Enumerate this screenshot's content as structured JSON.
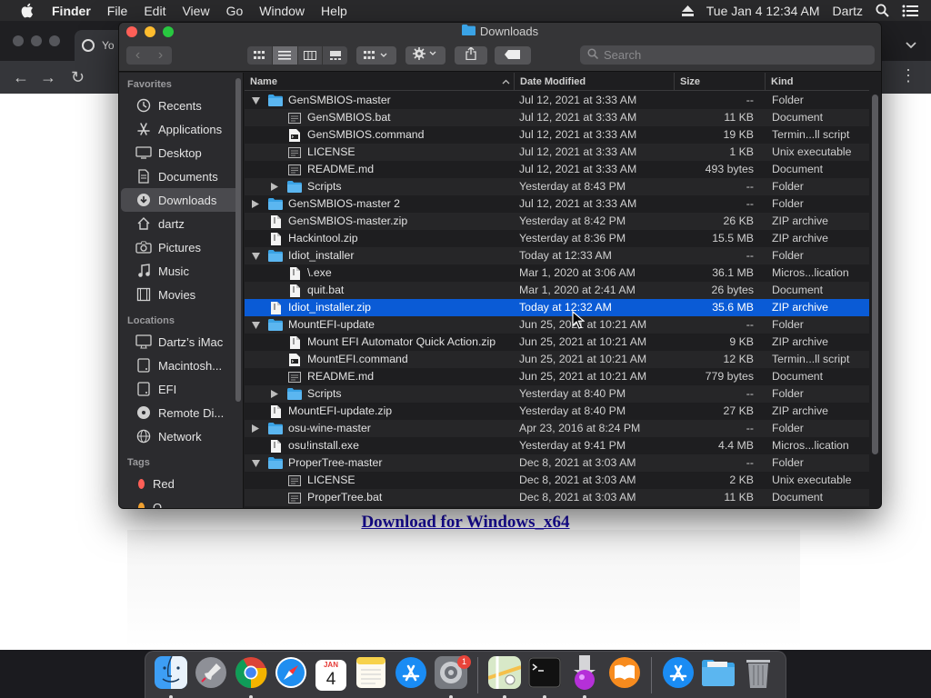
{
  "menubar": {
    "app_name": "Finder",
    "items": [
      "File",
      "Edit",
      "View",
      "Go",
      "Window",
      "Help"
    ],
    "clock": "Tue Jan 4  12:34 AM",
    "user": "Dartz"
  },
  "browser": {
    "tab_title": "Yo",
    "download_link": "Download for Windows_x64"
  },
  "finder": {
    "title": "Downloads",
    "search_placeholder": "Search",
    "columns": {
      "name": "Name",
      "date": "Date Modified",
      "size": "Size",
      "kind": "Kind"
    },
    "sidebar": {
      "favorites_label": "Favorites",
      "favorites": [
        {
          "label": "Recents",
          "icon": "clock-icon"
        },
        {
          "label": "Applications",
          "icon": "applications-icon"
        },
        {
          "label": "Desktop",
          "icon": "desktop-icon"
        },
        {
          "label": "Documents",
          "icon": "document-icon"
        },
        {
          "label": "Downloads",
          "icon": "download-icon",
          "selected": true
        },
        {
          "label": "dartz",
          "icon": "home-icon"
        },
        {
          "label": "Pictures",
          "icon": "camera-icon"
        },
        {
          "label": "Music",
          "icon": "music-icon"
        },
        {
          "label": "Movies",
          "icon": "film-icon"
        }
      ],
      "locations_label": "Locations",
      "locations": [
        {
          "label": "Dartz’s iMac",
          "icon": "imac-icon"
        },
        {
          "label": "Macintosh...",
          "icon": "disk-icon"
        },
        {
          "label": "EFI",
          "icon": "disk-icon"
        },
        {
          "label": "Remote Di...",
          "icon": "remote-disc-icon"
        },
        {
          "label": "Network",
          "icon": "globe-icon"
        }
      ],
      "tags_label": "Tags",
      "tags": [
        {
          "label": "Red",
          "color": "#fe5f57"
        },
        {
          "label": "O",
          "color": "#f0a030"
        }
      ]
    },
    "rows": [
      {
        "name": "GenSMBIOS-master",
        "date": "Jul 12, 2021 at 3:33 AM",
        "size": "--",
        "kind": "Folder",
        "type": "folder",
        "depth": 0,
        "disclosure": "open"
      },
      {
        "name": "GenSMBIOS.bat",
        "date": "Jul 12, 2021 at 3:33 AM",
        "size": "11 KB",
        "kind": "Document",
        "type": "doc",
        "depth": 1,
        "disclosure": "none"
      },
      {
        "name": "GenSMBIOS.command",
        "date": "Jul 12, 2021 at 3:33 AM",
        "size": "19 KB",
        "kind": "Termin...ll script",
        "type": "script",
        "depth": 1,
        "disclosure": "none"
      },
      {
        "name": "LICENSE",
        "date": "Jul 12, 2021 at 3:33 AM",
        "size": "1 KB",
        "kind": "Unix executable",
        "type": "exec",
        "depth": 1,
        "disclosure": "none"
      },
      {
        "name": "README.md",
        "date": "Jul 12, 2021 at 3:33 AM",
        "size": "493 bytes",
        "kind": "Document",
        "type": "doc",
        "depth": 1,
        "disclosure": "none"
      },
      {
        "name": "Scripts",
        "date": "Yesterday at 8:43 PM",
        "size": "--",
        "kind": "Folder",
        "type": "folder",
        "depth": 1,
        "disclosure": "closed"
      },
      {
        "name": "GenSMBIOS-master 2",
        "date": "Jul 12, 2021 at 3:33 AM",
        "size": "--",
        "kind": "Folder",
        "type": "folder",
        "depth": 0,
        "disclosure": "closed"
      },
      {
        "name": "GenSMBIOS-master.zip",
        "date": "Yesterday at 8:42 PM",
        "size": "26 KB",
        "kind": "ZIP archive",
        "type": "file",
        "depth": 0,
        "disclosure": "none"
      },
      {
        "name": "Hackintool.zip",
        "date": "Yesterday at 8:36 PM",
        "size": "15.5 MB",
        "kind": "ZIP archive",
        "type": "file",
        "depth": 0,
        "disclosure": "none"
      },
      {
        "name": "Idiot_installer",
        "date": "Today at 12:33 AM",
        "size": "--",
        "kind": "Folder",
        "type": "folder",
        "depth": 0,
        "disclosure": "open"
      },
      {
        "name": "\\.exe",
        "date": "Mar 1, 2020 at 3:06 AM",
        "size": "36.1 MB",
        "kind": "Micros...lication",
        "type": "file",
        "depth": 1,
        "disclosure": "none"
      },
      {
        "name": "quit.bat",
        "date": "Mar 1, 2020 at 2:41 AM",
        "size": "26 bytes",
        "kind": "Document",
        "type": "file",
        "depth": 1,
        "disclosure": "none"
      },
      {
        "name": "Idiot_installer.zip",
        "date": "Today at 12:32 AM",
        "size": "35.6 MB",
        "kind": "ZIP archive",
        "type": "file",
        "depth": 0,
        "disclosure": "none",
        "selected": true
      },
      {
        "name": "MountEFI-update",
        "date": "Jun 25, 2021 at 10:21 AM",
        "size": "--",
        "kind": "Folder",
        "type": "folder",
        "depth": 0,
        "disclosure": "open"
      },
      {
        "name": "Mount EFI Automator Quick Action.zip",
        "date": "Jun 25, 2021 at 10:21 AM",
        "size": "9 KB",
        "kind": "ZIP archive",
        "type": "file",
        "depth": 1,
        "disclosure": "none"
      },
      {
        "name": "MountEFI.command",
        "date": "Jun 25, 2021 at 10:21 AM",
        "size": "12 KB",
        "kind": "Termin...ll script",
        "type": "script",
        "depth": 1,
        "disclosure": "none"
      },
      {
        "name": "README.md",
        "date": "Jun 25, 2021 at 10:21 AM",
        "size": "779 bytes",
        "kind": "Document",
        "type": "doc",
        "depth": 1,
        "disclosure": "none"
      },
      {
        "name": "Scripts",
        "date": "Yesterday at 8:40 PM",
        "size": "--",
        "kind": "Folder",
        "type": "folder",
        "depth": 1,
        "disclosure": "closed"
      },
      {
        "name": "MountEFI-update.zip",
        "date": "Yesterday at 8:40 PM",
        "size": "27 KB",
        "kind": "ZIP archive",
        "type": "file",
        "depth": 0,
        "disclosure": "none"
      },
      {
        "name": "osu-wine-master",
        "date": "Apr 23, 2016 at 8:24 PM",
        "size": "--",
        "kind": "Folder",
        "type": "folder",
        "depth": 0,
        "disclosure": "closed"
      },
      {
        "name": "osu!install.exe",
        "date": "Yesterday at 9:41 PM",
        "size": "4.4 MB",
        "kind": "Micros...lication",
        "type": "file",
        "depth": 0,
        "disclosure": "none"
      },
      {
        "name": "ProperTree-master",
        "date": "Dec 8, 2021 at 3:03 AM",
        "size": "--",
        "kind": "Folder",
        "type": "folder",
        "depth": 0,
        "disclosure": "open"
      },
      {
        "name": "LICENSE",
        "date": "Dec 8, 2021 at 3:03 AM",
        "size": "2 KB",
        "kind": "Unix executable",
        "type": "exec",
        "depth": 1,
        "disclosure": "none"
      },
      {
        "name": "ProperTree.bat",
        "date": "Dec 8, 2021 at 3:03 AM",
        "size": "11 KB",
        "kind": "Document",
        "type": "doc",
        "depth": 1,
        "disclosure": "none"
      }
    ]
  },
  "dock": {
    "calendar_month": "JAN",
    "calendar_day": "4",
    "settings_badge": "1",
    "apps": [
      {
        "id": "finder",
        "icon": "finder-icon",
        "running": true
      },
      {
        "id": "launchpad",
        "icon": "launchpad-icon",
        "running": false
      },
      {
        "id": "chrome",
        "icon": "chrome-icon",
        "running": true
      },
      {
        "id": "safari",
        "icon": "safari-icon",
        "running": false
      },
      {
        "id": "calendar",
        "icon": "calendar-icon",
        "running": false
      },
      {
        "id": "notes",
        "icon": "notes-icon",
        "running": false
      },
      {
        "id": "app-store",
        "icon": "app-store-icon",
        "running": false
      },
      {
        "id": "system-preferences",
        "icon": "gear-icon",
        "running": true
      },
      {
        "id": "maps",
        "icon": "maps-icon",
        "running": true
      },
      {
        "id": "terminal",
        "icon": "terminal-icon",
        "running": true
      },
      {
        "id": "installer",
        "icon": "installer-icon",
        "running": true
      },
      {
        "id": "books",
        "icon": "books-icon",
        "running": false
      },
      {
        "id": "applications-stack",
        "icon": "app-store-icon",
        "running": false
      },
      {
        "id": "downloads-stack",
        "icon": "folder-icon",
        "running": false
      },
      {
        "id": "trash",
        "icon": "trash-icon",
        "running": false
      }
    ]
  },
  "colors": {
    "selection": "#0a5bd6",
    "folder": "#3aa3e6",
    "close": "#fe5f57",
    "minimize": "#febc2e",
    "maximize": "#28c840"
  }
}
